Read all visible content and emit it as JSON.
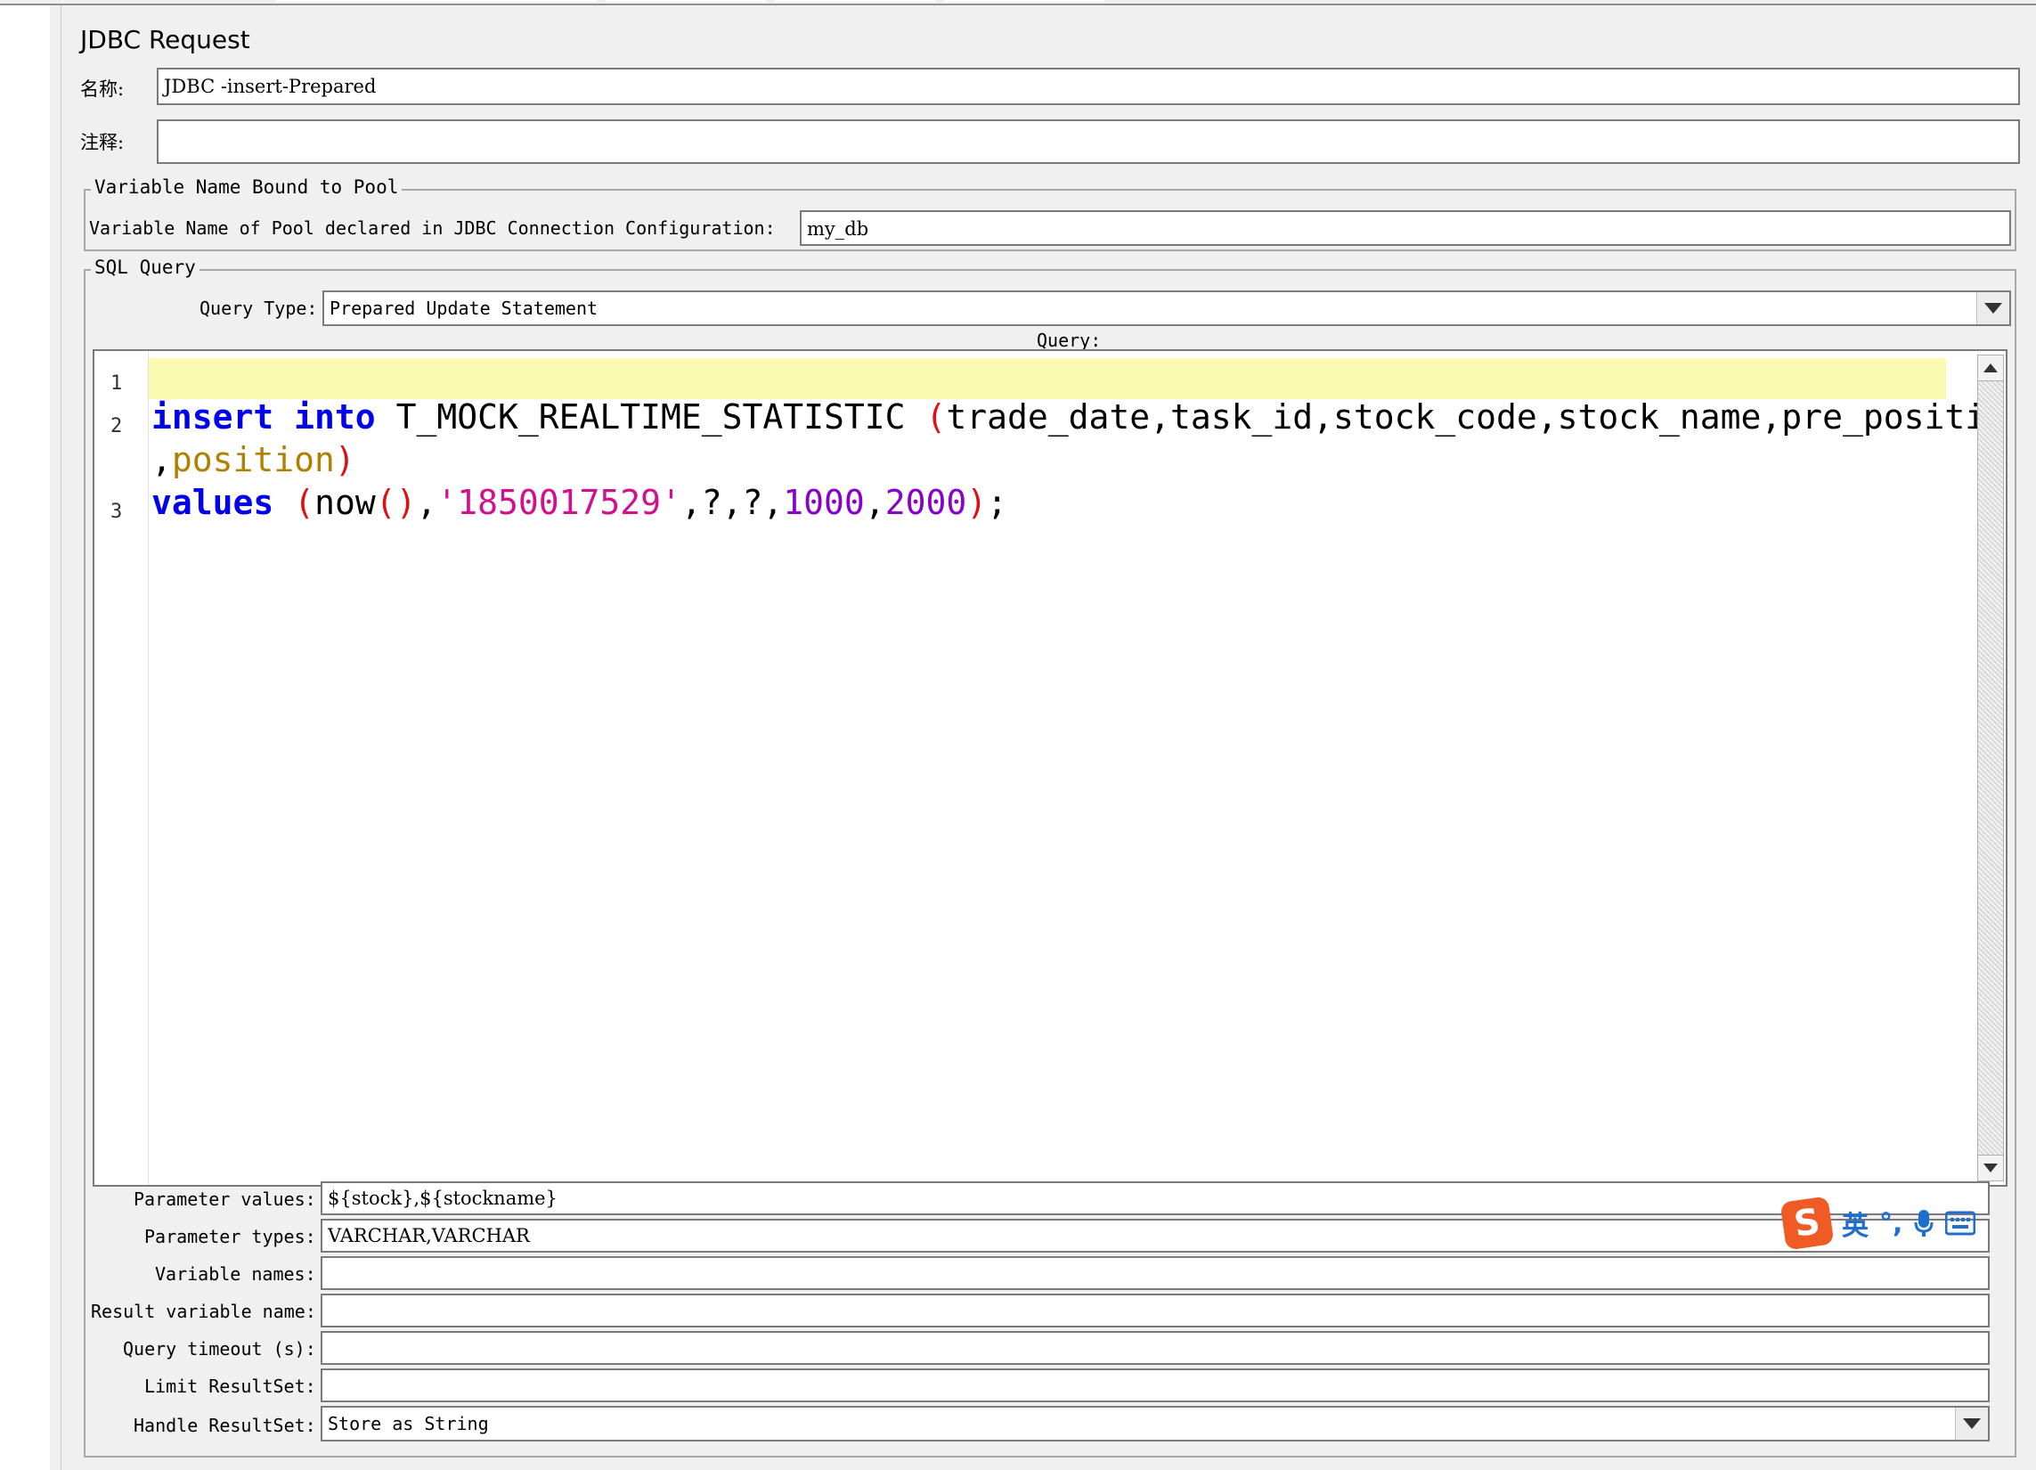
{
  "panel": {
    "title": "JDBC Request",
    "name_label": "名称:",
    "name_value": "JDBC -insert-Prepared",
    "comment_label": "注释:",
    "comment_value": ""
  },
  "pool_group": {
    "legend": "Variable Name Bound to Pool",
    "pool_label": "Variable Name of Pool declared in JDBC Connection Configuration:",
    "pool_value": "my_db"
  },
  "sql_group": {
    "legend": "SQL Query",
    "query_type_label": "Query Type:",
    "query_type_value": "Prepared Update Statement",
    "query_label": "Query:",
    "line_numbers": [
      "1",
      "2",
      "3"
    ],
    "code": {
      "l2_kw1": "insert",
      "l2_kw2": "into",
      "l2_table": "T_MOCK_REALTIME_STATISTIC",
      "l2_open": "(",
      "l2_cols": "trade_date,task_id,stock_code,stock_name,pre_position",
      "l2b_comma": ",",
      "l2b_col": "position",
      "l2b_close": ")",
      "l3_kw": "values",
      "l3_open": "(",
      "l3_fn": "now",
      "l3_fn_parens": "()",
      "l3_sep1": ",",
      "l3_str": "'1850017529'",
      "l3_sep2": ",?,?,",
      "l3_num1": "1000",
      "l3_sep3": ",",
      "l3_num2": "2000",
      "l3_close": ")",
      "l3_end": ";"
    }
  },
  "params": {
    "param_values_label": "Parameter values:",
    "param_values": "${stock},${stockname}",
    "param_types_label": "Parameter types:",
    "param_types": "VARCHAR,VARCHAR",
    "var_names_label": "Variable names:",
    "var_names": "",
    "result_var_label": "Result variable name:",
    "result_var": "",
    "timeout_label": "Query timeout (s):",
    "timeout": "",
    "limit_label": "Limit ResultSet:",
    "limit": "",
    "handle_label": "Handle ResultSet:",
    "handle_value": "Store as String"
  },
  "ime_toolbar": {
    "logo": "S",
    "mode": "英",
    "punct": "°,",
    "mic_icon": "microphone-icon",
    "keyboard_icon": "keyboard-icon"
  }
}
